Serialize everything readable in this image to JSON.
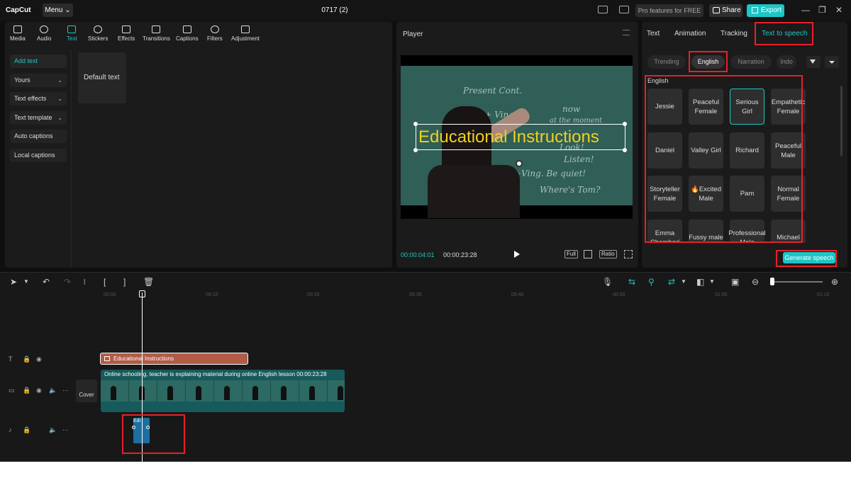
{
  "titlebar": {
    "logo": "CapCut",
    "menu": "Menu ⌄",
    "project_title": "0717 (2)",
    "pro_label": "Pro features for FREE",
    "share": "Share",
    "export": "Export"
  },
  "left_tabs": [
    {
      "label": "Media"
    },
    {
      "label": "Audio"
    },
    {
      "label": "Text"
    },
    {
      "label": "Stickers"
    },
    {
      "label": "Effects"
    },
    {
      "label": "Transitions"
    },
    {
      "label": "Captions"
    },
    {
      "label": "Filters"
    },
    {
      "label": "Adjustment"
    }
  ],
  "left_sidebar": [
    {
      "label": "Add text"
    },
    {
      "label": "Yours"
    },
    {
      "label": "Text effects"
    },
    {
      "label": "Text template"
    },
    {
      "label": "Auto captions"
    },
    {
      "label": "Local captions"
    }
  ],
  "default_text": "Default text",
  "player": {
    "title": "Player",
    "overlay_text": "Educational Instructions",
    "current_time": "00:00:04:01",
    "total_time": "00:00:23:28",
    "full": "Full",
    "ratio": "Ratio",
    "board_lines": [
      "Present Cont.",
      "am + Ving",
      "now",
      "at the moment",
      "Look!",
      "Listen!",
      "are+Ving. Be quiet!",
      "Where's Tom?"
    ]
  },
  "right_tabs": [
    {
      "label": "Text"
    },
    {
      "label": "Animation"
    },
    {
      "label": "Tracking"
    },
    {
      "label": "Text to speech"
    }
  ],
  "filters": [
    {
      "label": "Trending"
    },
    {
      "label": "English"
    },
    {
      "label": "Narration"
    },
    {
      "label": "Indo"
    }
  ],
  "language_label": "English",
  "voices": [
    {
      "label": "Jessie"
    },
    {
      "label": "Peaceful Female"
    },
    {
      "label": "Serious Girl"
    },
    {
      "label": "Empathetic Female"
    },
    {
      "label": "Daniel"
    },
    {
      "label": "Valley Girl"
    },
    {
      "label": "Richard"
    },
    {
      "label": "Peaceful Male"
    },
    {
      "label": "Storyteller Female"
    },
    {
      "label": "🔥Excited Male"
    },
    {
      "label": "Pam"
    },
    {
      "label": "Normal Female"
    },
    {
      "label": "Emma Chamberl"
    },
    {
      "label": "Fussy male"
    },
    {
      "label": "Professional Male"
    },
    {
      "label": "Michael"
    }
  ],
  "generate": "Generate speech",
  "timeline": {
    "ruler": [
      "00:00",
      "00:10",
      "00:20",
      "00:30",
      "00:40",
      "00:50",
      "01:00",
      "01:10"
    ],
    "text_clip": "Educational Instructions",
    "video_clip_label": "Online schooling, teacher is explaining material during online English lesson   00:00:23:28",
    "cover": "Cover",
    "audio_clip": "Edi"
  },
  "colors": {
    "accent": "#1ec5c6",
    "highlight": "#e8202a",
    "text_clip": "#b25b45",
    "audio_clip": "#1e6fa0"
  }
}
